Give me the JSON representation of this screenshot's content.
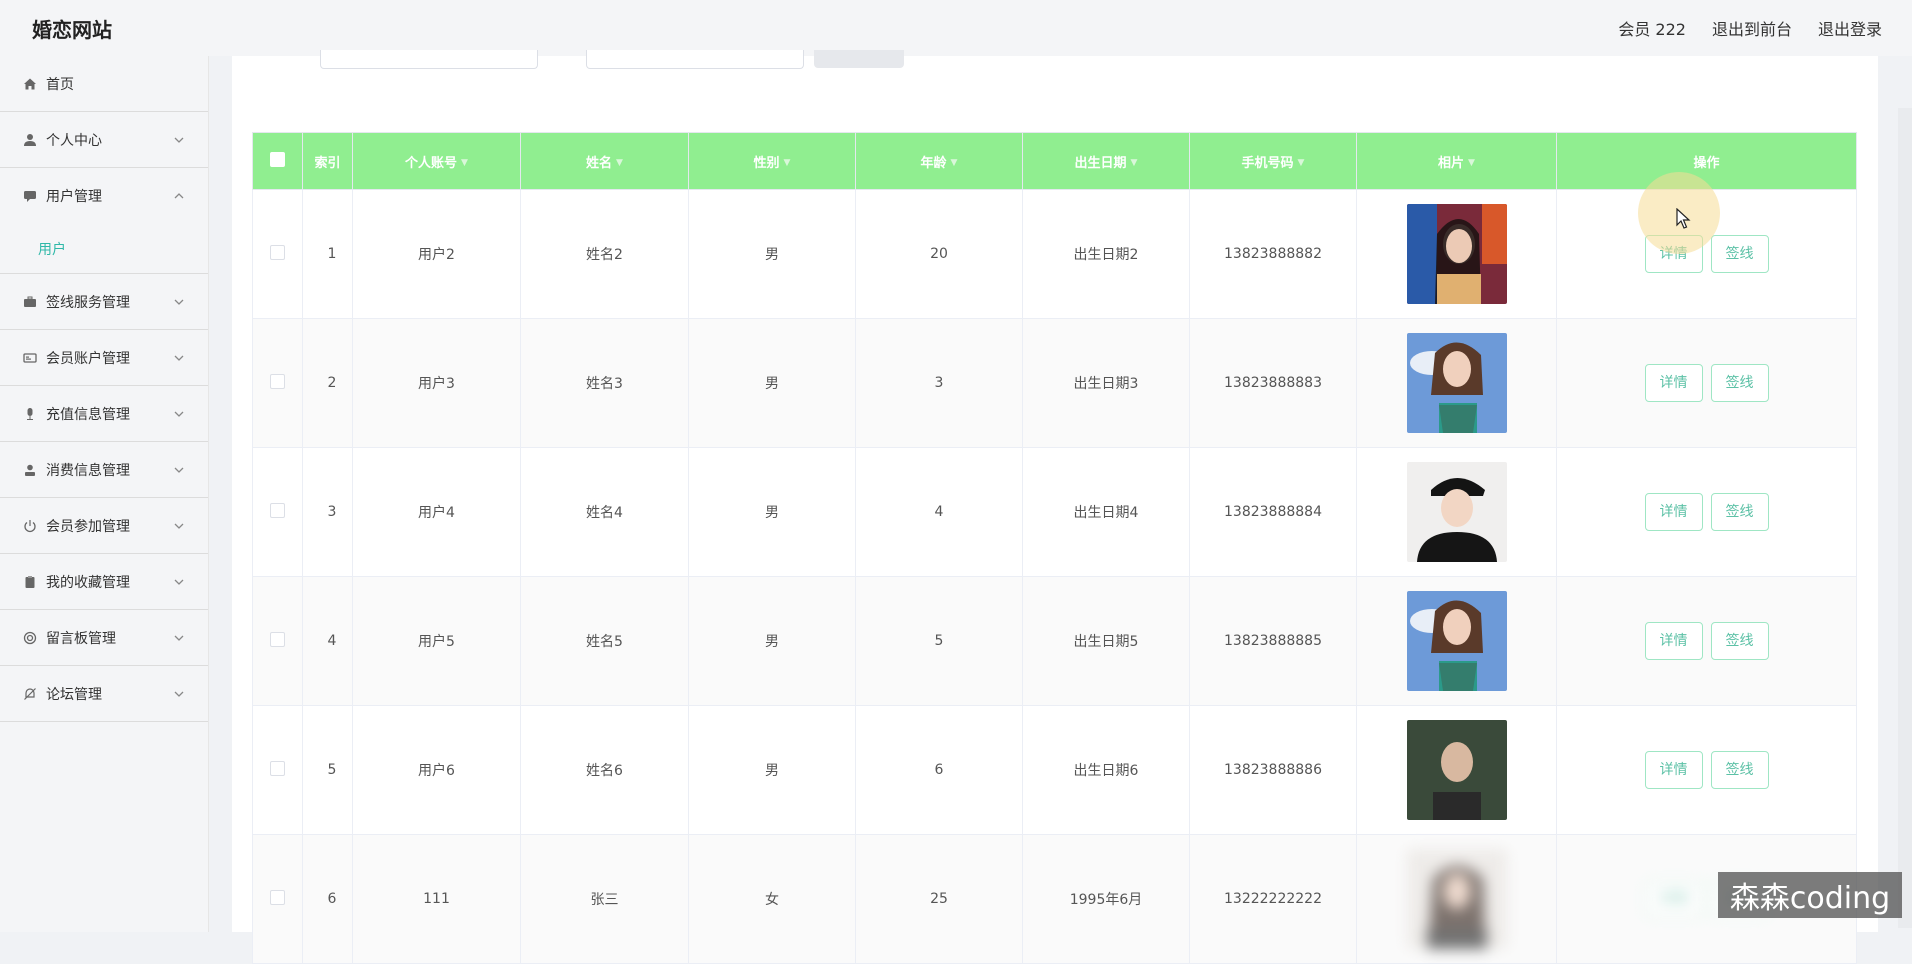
{
  "header": {
    "brand": "婚恋网站",
    "member": "会员 222",
    "to_front": "退出到前台",
    "logout": "退出登录"
  },
  "sidebar": {
    "items": [
      {
        "label": "首页",
        "icon": "home-icon"
      },
      {
        "label": "个人中心",
        "icon": "user-icon"
      },
      {
        "label": "用户管理",
        "icon": "chat-icon",
        "expanded": true,
        "children": [
          {
            "label": "用户"
          }
        ]
      },
      {
        "label": "签线服务管理",
        "icon": "briefcase-icon"
      },
      {
        "label": "会员账户管理",
        "icon": "id-card-icon"
      },
      {
        "label": "充值信息管理",
        "icon": "microphone-icon"
      },
      {
        "label": "消费信息管理",
        "icon": "person-icon"
      },
      {
        "label": "会员参加管理",
        "icon": "power-icon"
      },
      {
        "label": "我的收藏管理",
        "icon": "clipboard-icon"
      },
      {
        "label": "留言板管理",
        "icon": "target-icon"
      },
      {
        "label": "论坛管理",
        "icon": "bell-off-icon"
      }
    ],
    "active_sub": "用户"
  },
  "table": {
    "columns": [
      "索引",
      "个人账号",
      "姓名",
      "性别",
      "年龄",
      "出生日期",
      "手机号码",
      "相片",
      "操作"
    ],
    "rows": [
      {
        "index": "1",
        "account": "用户2",
        "name": "姓名2",
        "gender": "男",
        "age": "20",
        "birth": "出生日期2",
        "phone": "13823888882"
      },
      {
        "index": "2",
        "account": "用户3",
        "name": "姓名3",
        "gender": "男",
        "age": "3",
        "birth": "出生日期3",
        "phone": "13823888883"
      },
      {
        "index": "3",
        "account": "用户4",
        "name": "姓名4",
        "gender": "男",
        "age": "4",
        "birth": "出生日期4",
        "phone": "13823888884"
      },
      {
        "index": "4",
        "account": "用户5",
        "name": "姓名5",
        "gender": "男",
        "age": "5",
        "birth": "出生日期5",
        "phone": "13823888885"
      },
      {
        "index": "5",
        "account": "用户6",
        "name": "姓名6",
        "gender": "男",
        "age": "6",
        "birth": "出生日期6",
        "phone": "13823888886"
      },
      {
        "index": "6",
        "account": "111",
        "name": "张三",
        "gender": "女",
        "age": "25",
        "birth": "1995年6月",
        "phone": "13222222222"
      }
    ],
    "detail_label": "详情",
    "sign_label": "签线"
  },
  "watermark": "森森coding",
  "colors": {
    "header_green": "#90ee90",
    "accent": "#2fb8a8"
  }
}
